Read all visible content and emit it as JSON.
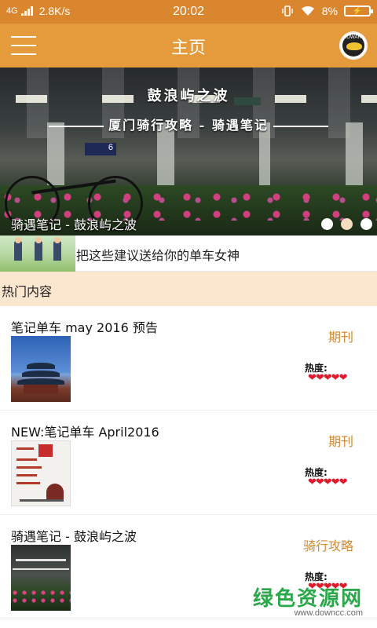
{
  "status_bar": {
    "network": "4G",
    "speed": "2.8K/s",
    "time": "20:02",
    "battery": "8%",
    "icons": [
      "signal-icon",
      "vibrate-icon",
      "wifi-icon",
      "battery-charging-icon"
    ]
  },
  "app_bar": {
    "title": "主页",
    "menu_icon": "hamburger-menu-icon",
    "logo_text": "LOWAR",
    "accent_color": "#e59b3b"
  },
  "banner": {
    "title_line1": "鼓浪屿之波",
    "title_line2": "厦门骑行攻略 - 骑遇笔记",
    "caption": "骑遇笔记 - 鼓浪屿之波",
    "sign_number": "6",
    "page_count": 3,
    "active_page": 2
  },
  "headline": {
    "text": "把这些建议送给你的单车女神"
  },
  "section": {
    "title": "热门内容",
    "background": "#fbe6cf"
  },
  "items": [
    {
      "title": "笔记单车 may 2016 预告",
      "category": "期刊",
      "heat_label": "热度:",
      "hearts": "❤❤❤❤❤",
      "heat": 5
    },
    {
      "title": "NEW:笔记单车 April2016",
      "category": "期刊",
      "heat_label": "热度:",
      "hearts": "❤❤❤❤❤",
      "heat": 5
    },
    {
      "title": "骑遇笔记 - 鼓浪屿之波",
      "category": "骑行攻略",
      "heat_label": "热度:",
      "hearts": "❤❤❤❤❤",
      "heat": 5
    }
  ],
  "watermark": {
    "main": "绿色资源网",
    "url": "www.downcc.com"
  }
}
